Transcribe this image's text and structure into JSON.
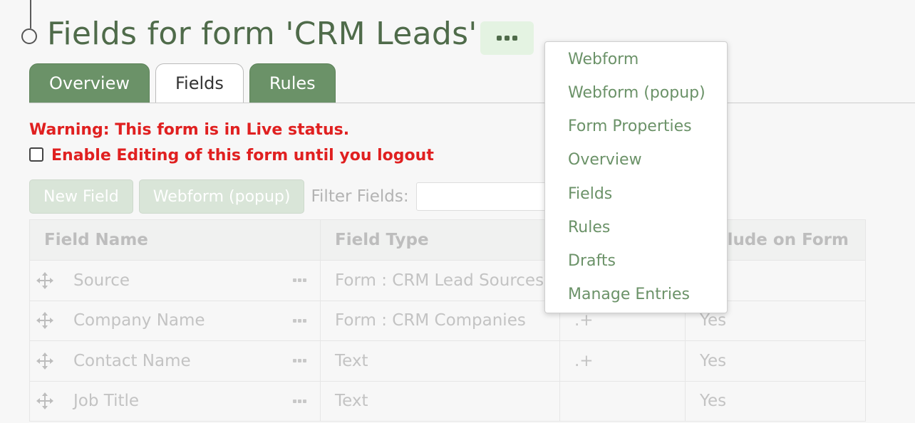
{
  "title": "Fields for form 'CRM Leads'",
  "header": {
    "more_icon": "ellipsis-icon"
  },
  "tabs": [
    {
      "label": "Overview",
      "active": false
    },
    {
      "label": "Fields",
      "active": true
    },
    {
      "label": "Rules",
      "active": false
    }
  ],
  "warning": "Warning: This form is in Live status.",
  "enable_editing": {
    "label": "Enable Editing of this form until you logout",
    "checked": false
  },
  "toolbar": {
    "new_field_label": "New Field",
    "webform_popup_label": "Webform (popup)",
    "filter_label": "Filter Fields:",
    "filter_value": ""
  },
  "table": {
    "columns": [
      "Field Name",
      "Field Type",
      "",
      "Include on Form"
    ],
    "rows": [
      {
        "name": "Source",
        "type": "Form : CRM Lead Sources",
        "validation": "",
        "include": ""
      },
      {
        "name": "Company Name",
        "type": "Form : CRM Companies",
        "validation": ".+",
        "include": "Yes"
      },
      {
        "name": "Contact Name",
        "type": "Text",
        "validation": ".+",
        "include": "Yes"
      },
      {
        "name": "Job Title",
        "type": "Text",
        "validation": "",
        "include": "Yes"
      }
    ]
  },
  "dropdown_menu": {
    "items": [
      "Webform",
      "Webform (popup)",
      "Form Properties",
      "Overview",
      "Fields",
      "Rules",
      "Drafts",
      "Manage Entries"
    ]
  },
  "colors": {
    "accent_green": "#6b9268",
    "title_green": "#4f6b4a",
    "warning_red": "#e02020",
    "menu_bg": "#ffffff"
  }
}
